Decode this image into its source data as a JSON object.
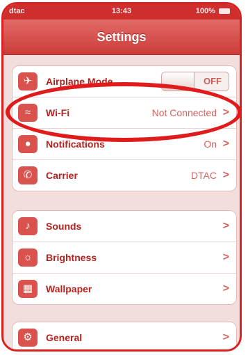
{
  "status_bar": {
    "carrier": "dtac",
    "time": "13:43",
    "battery": "100%",
    "battery_icon": "battery-icon"
  },
  "nav": {
    "title": "Settings"
  },
  "groups": [
    [
      {
        "label": "Airplane Mode",
        "toggle": "OFF",
        "icon": "airplane-icon"
      },
      {
        "label": "Wi-Fi",
        "value": "Not Connected",
        "icon": "wifi-icon"
      },
      {
        "label": "Notifications",
        "value": "On",
        "icon": "notifications-icon"
      },
      {
        "label": "Carrier",
        "value": "DTAC",
        "icon": "carrier-phone-icon"
      }
    ],
    [
      {
        "label": "Sounds",
        "icon": "sounds-speaker-icon"
      },
      {
        "label": "Brightness",
        "icon": "brightness-sun-icon"
      },
      {
        "label": "Wallpaper",
        "icon": "wallpaper-image-icon"
      }
    ],
    [
      {
        "label": "General",
        "icon": "general-gear-icon"
      }
    ]
  ],
  "chevron": ">",
  "colors": {
    "accent": "#cc3d39",
    "highlight": "#e01b1b",
    "frame": "#d9221f"
  }
}
